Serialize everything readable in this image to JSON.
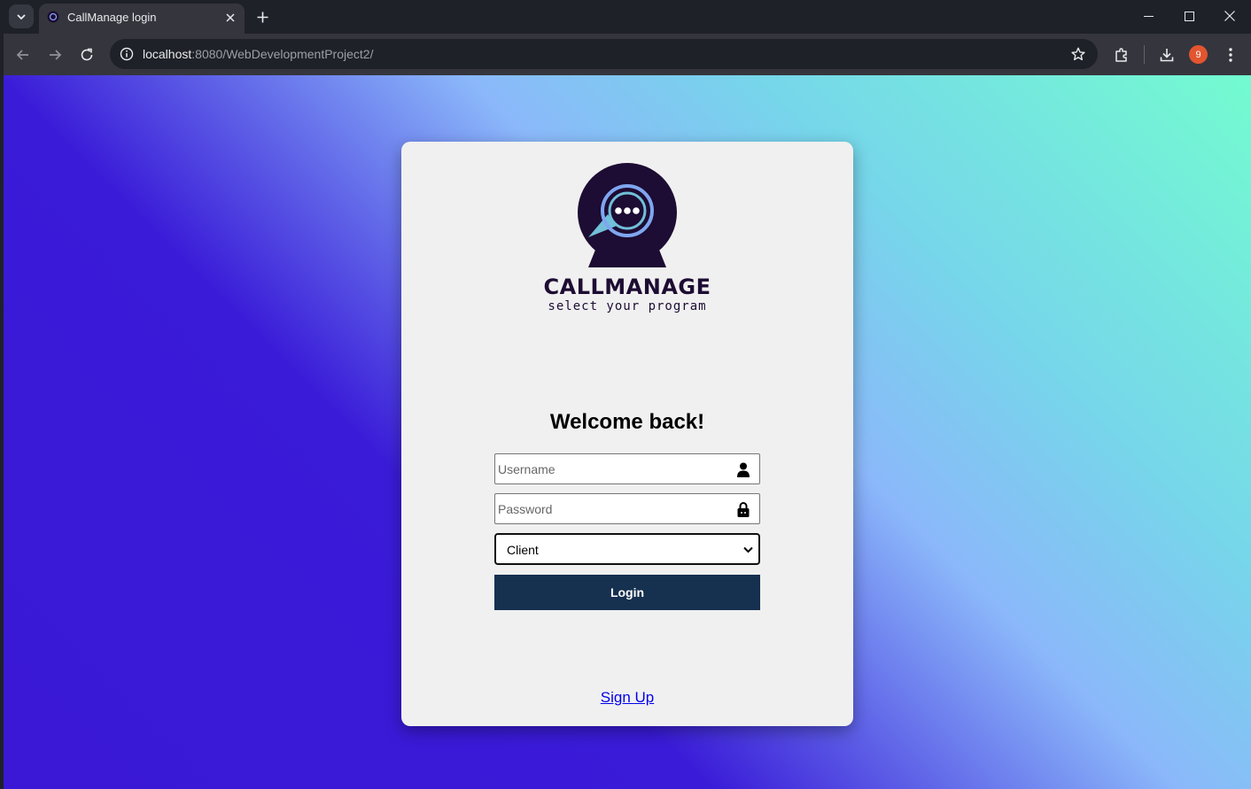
{
  "browser": {
    "tab_title": "CallManage login",
    "url_host": "localhost",
    "url_rest": ":8080/WebDevelopmentProject2/",
    "profile_initial": "9",
    "profile_color": "#e2552f"
  },
  "page": {
    "brand": "CALLMANAGE",
    "tagline": "select your program",
    "welcome": "Welcome back!",
    "username_placeholder": "Username",
    "password_placeholder": "Password",
    "role_selected": "Client",
    "login_label": "Login",
    "signup_label": "Sign Up",
    "accent_color": "#16304f"
  }
}
